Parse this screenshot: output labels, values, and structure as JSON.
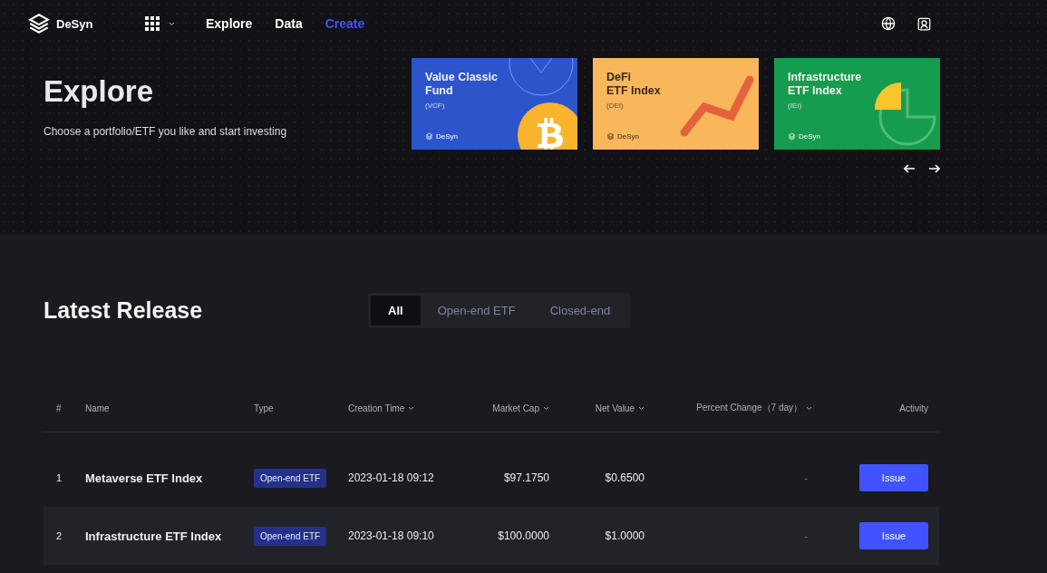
{
  "nav": {
    "brand": "DeSyn",
    "items": [
      {
        "label": "Explore",
        "selected": false
      },
      {
        "label": "Data",
        "selected": false
      },
      {
        "label": "Create",
        "selected": true
      }
    ]
  },
  "hero": {
    "title": "Explore",
    "subtitle": "Choose a portfolio/ETF you like and start investing",
    "cards": [
      {
        "kind": "coin",
        "color": "#2c55cc",
        "title_lines": [
          "Value Classic",
          "Fund"
        ],
        "code": "(VCF)",
        "brand": "DeSyn"
      },
      {
        "kind": "trend",
        "color": "#f9b75c",
        "title_lines": [
          "DeFi",
          "ETF Index"
        ],
        "code": "(DEI)",
        "brand": "DeSyn"
      },
      {
        "kind": "pie",
        "color": "#169c4e",
        "title_lines": [
          "Infrastructure",
          "ETF Index"
        ],
        "code": "(IEI)",
        "brand": "DeSyn"
      }
    ]
  },
  "release": {
    "title": "Latest Release",
    "tabs": [
      {
        "label": "All",
        "selected": true
      },
      {
        "label": "Open-end ETF",
        "selected": false
      },
      {
        "label": "Closed-end",
        "selected": false
      }
    ]
  },
  "table": {
    "columns": [
      {
        "label": "#",
        "sortable": false
      },
      {
        "label": "Name",
        "sortable": false
      },
      {
        "label": "Type",
        "sortable": false
      },
      {
        "label": "Creation Time",
        "sortable": true
      },
      {
        "label": "Market Cap",
        "sortable": true
      },
      {
        "label": "Net Value",
        "sortable": true
      },
      {
        "label": "Percent Change（7 day）",
        "sortable": true
      },
      {
        "label": "Activity",
        "sortable": false
      }
    ],
    "rows": [
      {
        "index": "1",
        "name": "Metaverse ETF Index",
        "type": "Open-end ETF",
        "created": "2023-01-18 09:12",
        "market_cap": "$97.1750",
        "net_value": "$0.6500",
        "change": "-",
        "action": "Issue"
      },
      {
        "index": "2",
        "name": "Infrastructure ETF Index",
        "type": "Open-end ETF",
        "created": "2023-01-18 09:10",
        "market_cap": "$100.0000",
        "net_value": "$1.0000",
        "change": "-",
        "action": "Issue"
      }
    ]
  }
}
